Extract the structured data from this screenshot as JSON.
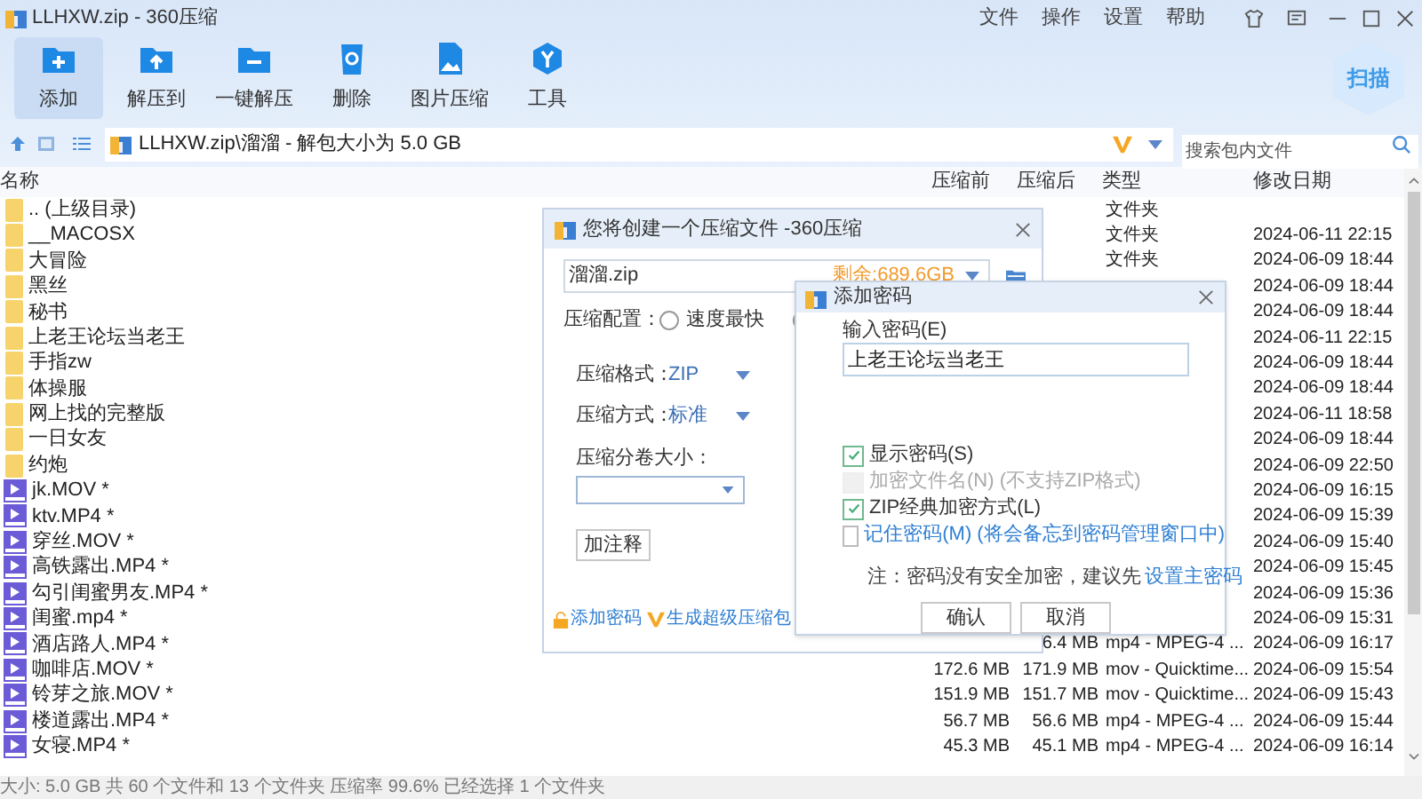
{
  "window": {
    "title": "LLHXW.zip - 360压缩"
  },
  "menu": [
    "文件",
    "操作",
    "设置",
    "帮助"
  ],
  "toolbar": [
    {
      "label": "添加",
      "kind": "add",
      "selected": true
    },
    {
      "label": "解压到",
      "kind": "extract",
      "selected": false
    },
    {
      "label": "一键解压",
      "kind": "quick",
      "selected": false
    },
    {
      "label": "删除",
      "kind": "delete",
      "selected": false
    },
    {
      "label": "图片压缩",
      "kind": "image",
      "selected": false
    },
    {
      "label": "工具",
      "kind": "tools",
      "selected": false
    }
  ],
  "scan_button": {
    "label": "扫描"
  },
  "address_bar": {
    "path": "LLHXW.zip\\溜溜 - 解包大小为 5.0 GB"
  },
  "search": {
    "placeholder": "搜索包内文件"
  },
  "table": {
    "columns": [
      "名称",
      "压缩前",
      "压缩后",
      "类型",
      "修改日期"
    ],
    "rows": [
      {
        "name": ".. (上级目录)",
        "kind": "folder",
        "type": "文件夹"
      },
      {
        "name": "__MACOSX",
        "kind": "folder",
        "type": "文件夹",
        "modified": "2024-06-11 22:15"
      },
      {
        "name": "大冒险",
        "kind": "folder",
        "type": "文件夹",
        "modified": "2024-06-09 18:44"
      },
      {
        "name": "黑丝",
        "kind": "folder",
        "modified": "2024-06-09 18:44"
      },
      {
        "name": "秘书",
        "kind": "folder",
        "modified": "2024-06-09 18:44"
      },
      {
        "name": "上老王论坛当老王",
        "kind": "folder",
        "modified": "2024-06-11 22:15"
      },
      {
        "name": "手指zw",
        "kind": "folder",
        "modified": "2024-06-09 18:44"
      },
      {
        "name": "体操服",
        "kind": "folder",
        "modified": "2024-06-09 18:44"
      },
      {
        "name": "网上找的完整版",
        "kind": "folder",
        "modified": "2024-06-11 18:58"
      },
      {
        "name": "一日女友",
        "kind": "folder",
        "modified": "2024-06-09 18:44"
      },
      {
        "name": "约炮",
        "kind": "folder",
        "modified": "2024-06-09 22:50"
      },
      {
        "name": "jk.MOV *",
        "kind": "video",
        "modified": "2024-06-09 16:15"
      },
      {
        "name": "ktv.MP4 *",
        "kind": "video",
        "modified": "2024-06-09 15:39"
      },
      {
        "name": "穿丝.MOV *",
        "kind": "video",
        "modified": "2024-06-09 15:40"
      },
      {
        "name": "高铁露出.MP4 *",
        "kind": "video",
        "modified": "2024-06-09 15:45"
      },
      {
        "name": "勾引闺蜜男友.MP4 *",
        "kind": "video",
        "modified": "2024-06-09 15:36"
      },
      {
        "name": "闺蜜.mp4 *",
        "kind": "video",
        "modified": "2024-06-09 15:31"
      },
      {
        "name": "酒店路人.MP4 *",
        "kind": "video",
        "after": "6.4 MB",
        "type": "mp4 - MPEG-4 ...",
        "modified": "2024-06-09 16:17"
      },
      {
        "name": "咖啡店.MOV *",
        "kind": "video",
        "before": "172.6 MB",
        "after": "171.9 MB",
        "type": "mov - Quicktime...",
        "modified": "2024-06-09 15:54"
      },
      {
        "name": "铃芽之旅.MOV *",
        "kind": "video",
        "before": "151.9 MB",
        "after": "151.7 MB",
        "type": "mov - Quicktime...",
        "modified": "2024-06-09 15:43"
      },
      {
        "name": "楼道露出.MP4 *",
        "kind": "video",
        "before": "56.7 MB",
        "after": "56.6 MB",
        "type": "mp4 - MPEG-4 ...",
        "modified": "2024-06-09 15:44"
      },
      {
        "name": "女寝.MP4 *",
        "kind": "video",
        "before": "45.3 MB",
        "after": "45.1 MB",
        "type": "mp4 - MPEG-4 ...",
        "modified": "2024-06-09 16:14"
      }
    ]
  },
  "status_bar": "大小: 5.0 GB 共 60 个文件和 13 个文件夹 压缩率 99.6% 已经选择 1 个文件夹",
  "compress_dialog": {
    "title": "您将创建一个压缩文件 -360压缩",
    "filename": "溜溜.zip",
    "free_space": "剩余:689.6GB",
    "config_label": "压缩配置：",
    "config_options": [
      {
        "label": "速度最快",
        "selected": false
      },
      {
        "selected": false
      }
    ],
    "format_label": "压缩格式：",
    "format": "ZIP",
    "method_label": "压缩方式：",
    "method": "标准",
    "split_label": "压缩分卷大小：",
    "comment_button": "加注释",
    "links": [
      {
        "label": "添加密码",
        "kind": "lock"
      },
      {
        "label": "生成超级压缩包",
        "kind": "super"
      }
    ]
  },
  "password_dialog": {
    "title": "添加密码",
    "password_label": "输入密码(E)",
    "password": "上老王论坛当老王",
    "options": [
      {
        "label": "显示密码(S)",
        "checked": true,
        "disabled": false,
        "kind": "plain"
      },
      {
        "label": "加密文件名(N) (不支持ZIP格式)",
        "checked": false,
        "disabled": true,
        "kind": "plain"
      },
      {
        "label": "ZIP经典加密方式(L)",
        "checked": true,
        "disabled": false,
        "kind": "plain"
      },
      {
        "label": "记住密码(M) (将会备忘到密码管理窗口中)",
        "checked": false,
        "disabled": false,
        "kind": "link"
      }
    ],
    "note": "注：密码没有安全加密，建议先",
    "note_link": "设置主密码",
    "buttons": [
      "确认",
      "取消"
    ]
  }
}
